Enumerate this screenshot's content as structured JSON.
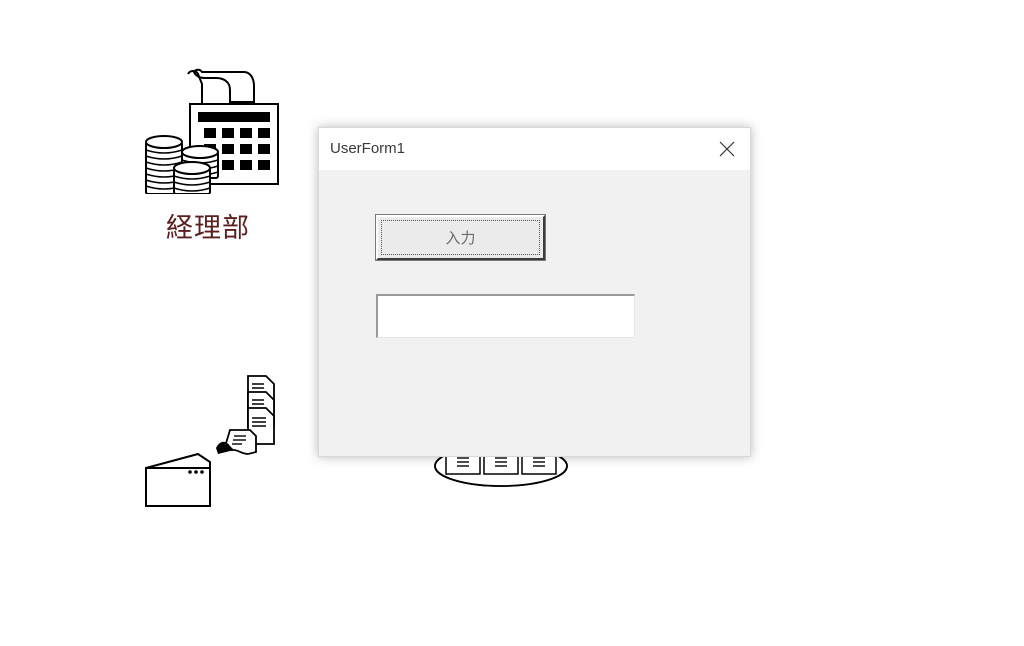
{
  "background": {
    "accounting": {
      "label": "経理部",
      "label_color": "#5a1f1f",
      "icon": "calculator-coins-icon"
    },
    "fax": {
      "icon": "fax-documents-icon"
    },
    "server": {
      "icon": "server-cluster-icon"
    }
  },
  "dialog": {
    "title": "UserForm1",
    "close_icon": "close-icon",
    "command_button": {
      "label": "入力"
    },
    "textbox": {
      "value": ""
    }
  }
}
